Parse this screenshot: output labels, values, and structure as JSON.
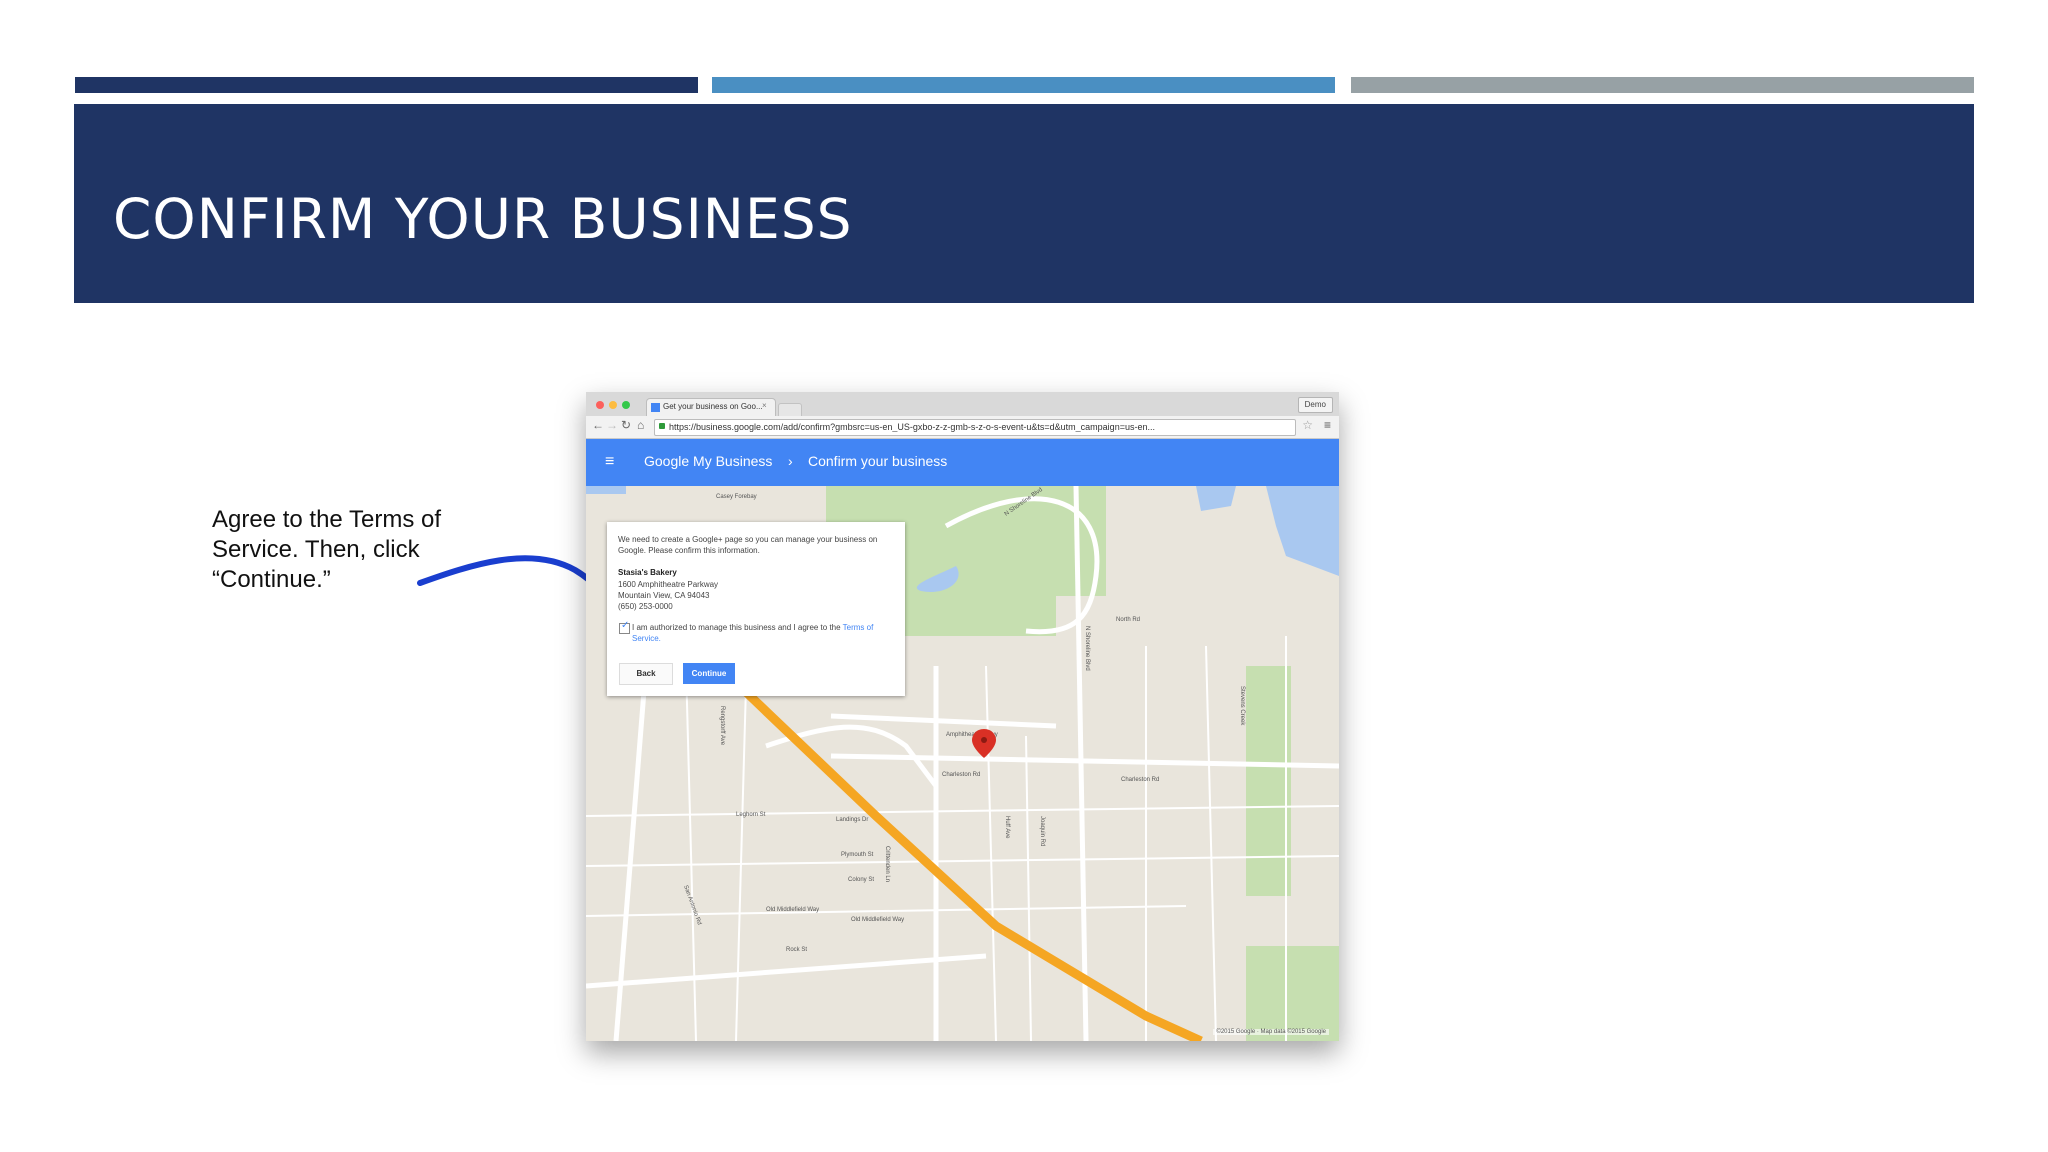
{
  "colors": {
    "bar_1": "#1f3464",
    "bar_2": "#4a8fc2",
    "bar_3": "#97a1a5",
    "title_band": "#1f3464",
    "app_bar": "#4285f4",
    "arrow": "#1a3ecf",
    "highway": "#f5a623",
    "park": "#c6dfb0",
    "water": "#a9c8f0",
    "map_pin": "#d93025"
  },
  "slide": {
    "title": "CONFIRM YOUR BUSINESS",
    "instruction": "Agree to the Terms of Service. Then, click “Continue.”"
  },
  "browser": {
    "tab_title": "Get your business on Goo...",
    "tab_close": "×",
    "profile_label": "Demo",
    "url": "https://business.google.com/add/confirm?gmbsrc=us-en_US-gxbo-z-z-gmb-s-z-o-s-event-u&ts=d&utm_campaign=us-en...",
    "nav_back": "←",
    "nav_forward": "→",
    "nav_reload": "↻",
    "nav_home": "⌂",
    "star": "☆",
    "menu": "≡"
  },
  "app": {
    "menu_glyph": "≡",
    "breadcrumb_root": "Google My Business",
    "breadcrumb_separator": "›",
    "breadcrumb_current": "Confirm your business"
  },
  "dialog": {
    "intro": "We need to create a Google+ page so you can manage your business on Google. Please confirm this information.",
    "business_name": "Stasia's Bakery",
    "address_line_1": "1600 Amphitheatre Parkway",
    "address_line_2": "Mountain View, CA 94043",
    "phone": "(650) 253-0000",
    "check_glyph": "✓",
    "consent_text": "I am authorized to manage this business and I agree to the",
    "terms_link": "Terms of Service.",
    "back_label": "Back",
    "continue_label": "Continue"
  },
  "map": {
    "labels": [
      "Casey Forebay",
      "N Shoreline Blvd",
      "N Shoreline Blvd",
      "North Rd",
      "Charleston Rd",
      "Charleston Rd",
      "Amphitheatre Pkwy",
      "Joaquin Rd",
      "Huff Ave",
      "Rengstorff Ave",
      "San Antonio Rd",
      "Leghorn St",
      "Landings Dr",
      "Plymouth St",
      "Old Middlefield Way",
      "Old Middlefield Way",
      "Rock St",
      "Colony St",
      "Crittenden Ln",
      "Stevens Creek"
    ],
    "copyright": "©2015 Google · Map data ©2015 Google"
  }
}
